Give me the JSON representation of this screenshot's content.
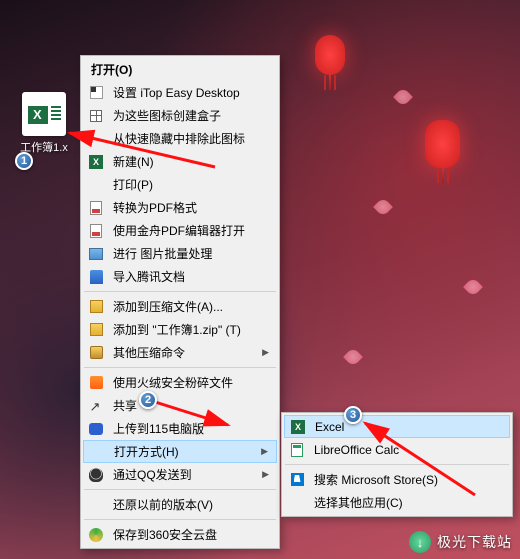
{
  "desktop_file": {
    "name": "工作簿1.x"
  },
  "badges": {
    "b1": "1",
    "b2": "2",
    "b3": "3"
  },
  "menu": {
    "open": "打开(O)",
    "itop": "设置 iTop Easy Desktop",
    "create_box": "为这些图标创建盒子",
    "hide_quick": "从快速隐藏中排除此图标",
    "new": "新建(N)",
    "print": "打印(P)",
    "to_pdf": "转换为PDF格式",
    "jinshan_pdf": "使用金舟PDF编辑器打开",
    "batch_img": "进行 图片批量处理",
    "tencent_doc": "导入腾讯文档",
    "add_zip": "添加到压缩文件(A)...",
    "add_zip_named": "添加到 \"工作簿1.zip\" (T)",
    "other_zip": "其他压缩命令",
    "huorong": "使用火绒安全粉碎文件",
    "share": "共享",
    "upload_115": "上传到115电脑版",
    "open_with": "打开方式(H)",
    "qq_send": "通过QQ发送到",
    "restore": "还原以前的版本(V)",
    "save_360": "保存到360安全云盘"
  },
  "submenu": {
    "excel": "Excel",
    "libre": "LibreOffice Calc",
    "ms_store": "搜索 Microsoft Store(S)",
    "other_app": "选择其他应用(C)"
  },
  "watermark": "极光下载站"
}
